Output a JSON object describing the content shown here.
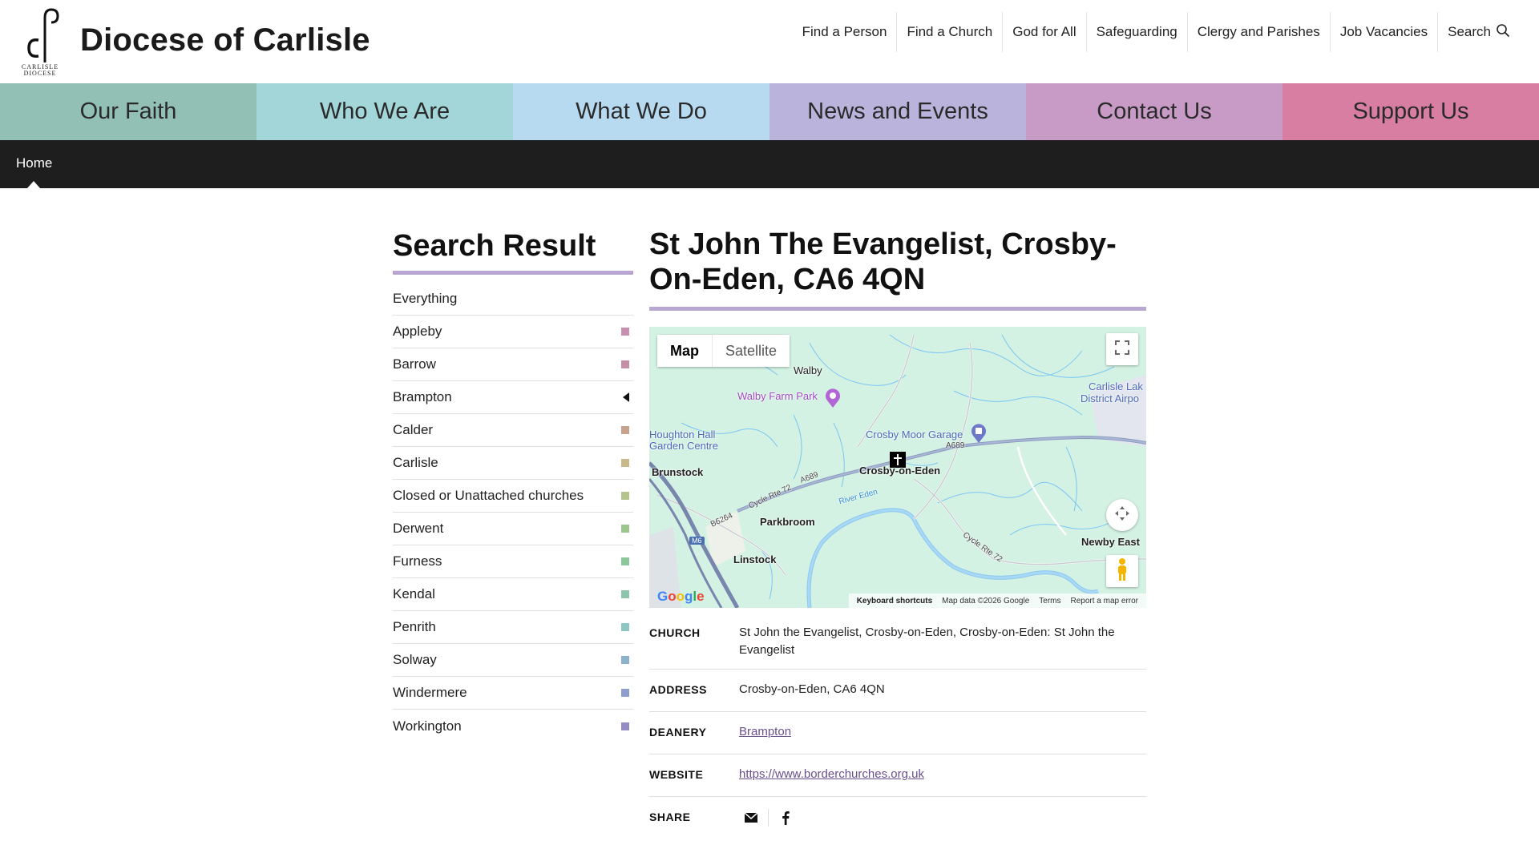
{
  "header": {
    "site_title": "Diocese of Carlisle",
    "logo_line1": "CARLISLE",
    "logo_line2": "DIOCESE",
    "util_nav": [
      "Find a Person",
      "Find a Church",
      "God for All",
      "Safeguarding",
      "Clergy and Parishes",
      "Job Vacancies",
      "Search"
    ]
  },
  "main_nav": [
    {
      "label": "Our Faith",
      "color": "#93c0b5"
    },
    {
      "label": "Who We Are",
      "color": "#a3d6d9"
    },
    {
      "label": "What We Do",
      "color": "#b7daf0"
    },
    {
      "label": "News and Events",
      "color": "#bab4dc"
    },
    {
      "label": "Contact Us",
      "color": "#c79bc6"
    },
    {
      "label": "Support Us",
      "color": "#d77ea2"
    }
  ],
  "breadcrumb": {
    "home": "Home"
  },
  "sidebar": {
    "title": "Search Result",
    "items": [
      {
        "label": "Everything",
        "swatch": ""
      },
      {
        "label": "Appleby",
        "swatch": "#c78fb0"
      },
      {
        "label": "Barrow",
        "swatch": "#c58fa5"
      },
      {
        "label": "Brampton",
        "swatch": "active"
      },
      {
        "label": "Calder",
        "swatch": "#c7a28d"
      },
      {
        "label": "Carlisle",
        "swatch": "#c8b98a"
      },
      {
        "label": "Closed or Unattached churches",
        "swatch": "#b5c48c"
      },
      {
        "label": "Derwent",
        "swatch": "#9cc68c"
      },
      {
        "label": "Furness",
        "swatch": "#8cc69b"
      },
      {
        "label": "Kendal",
        "swatch": "#8cc6ad"
      },
      {
        "label": "Penrith",
        "swatch": "#8cc5c2"
      },
      {
        "label": "Solway",
        "swatch": "#8cb1cb"
      },
      {
        "label": "Windermere",
        "swatch": "#8c9ecb"
      },
      {
        "label": "Workington",
        "swatch": "#968cc4"
      }
    ]
  },
  "content": {
    "title": "St John The Evangelist, Crosby-On-Eden, CA6 4QN"
  },
  "map": {
    "type_map": "Map",
    "type_satellite": "Satellite",
    "labels": {
      "walby": "Walby",
      "walby_farm_park": "Walby Farm Park",
      "carlisle_lake_1": "Carlisle Lak",
      "carlisle_lake_2": "District Airpo",
      "houghton_1": "Houghton Hall",
      "houghton_2": "Garden Centre",
      "crosby_moor": "Crosby Moor Garage",
      "a689_1": "A689",
      "a689_2": "A689",
      "brunstock": "Brunstock",
      "crosby_on_eden": "Crosby-on-Eden",
      "cycle72_1": "Cycle Rte 72",
      "cycle72_2": "Cycle Rte 72",
      "river_eden": "River Eden",
      "b6264": "B6264",
      "parkbroom": "Parkbroom",
      "m6": "M6",
      "linstock": "Linstock",
      "newby_east": "Newby East"
    },
    "footer": {
      "keyboard": "Keyboard shortcuts",
      "data": "Map data ©2026 Google",
      "terms": "Terms",
      "report": "Report a map error"
    },
    "google": "Google"
  },
  "details": {
    "church_label": "CHURCH",
    "church_value": "St John the Evangelist, Crosby-on-Eden, Crosby-on-Eden: St John the Evangelist",
    "address_label": "ADDRESS",
    "address_value": "Crosby-on-Eden, CA6 4QN",
    "deanery_label": "DEANERY",
    "deanery_value": "Brampton",
    "website_label": "WEBSITE",
    "website_value": "https://www.borderchurches.org.uk",
    "share_label": "SHARE"
  }
}
